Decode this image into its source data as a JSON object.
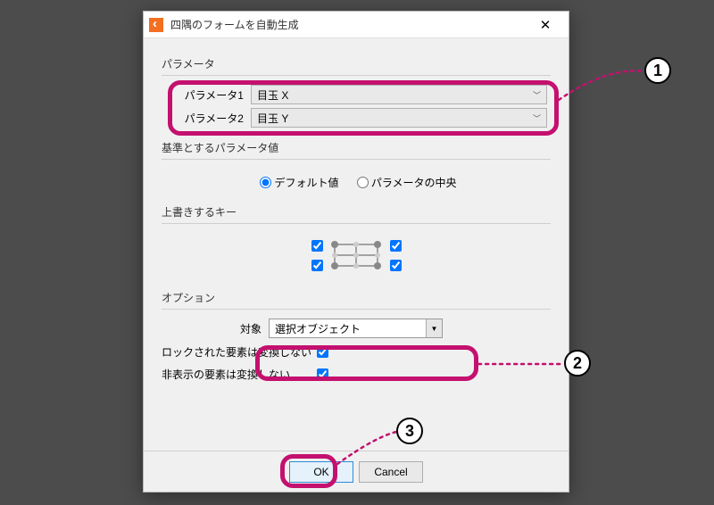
{
  "window": {
    "title": "四隅のフォームを自動生成"
  },
  "groups": {
    "parameters": "パラメータ",
    "baseline": "基準とするパラメータ値",
    "overwrite": "上書きするキー",
    "options": "オプション"
  },
  "params": {
    "label1": "パラメータ1",
    "value1": "目玉 X",
    "label2": "パラメータ2",
    "value2": "目玉 Y"
  },
  "baseline": {
    "default": "デフォルト値",
    "center": "パラメータの中央",
    "selected": "default"
  },
  "overwrite_keys": {
    "tl": true,
    "tr": true,
    "bl": true,
    "br": true
  },
  "options": {
    "target_label": "対象",
    "target_value": "選択オブジェクト",
    "lock_label": "ロックされた要素は変換しない",
    "lock_checked": true,
    "hidden_label": "非表示の要素は変換しない",
    "hidden_checked": true
  },
  "buttons": {
    "ok": "OK",
    "cancel": "Cancel"
  },
  "annotations": {
    "n1": "1",
    "n2": "2",
    "n3": "3"
  }
}
